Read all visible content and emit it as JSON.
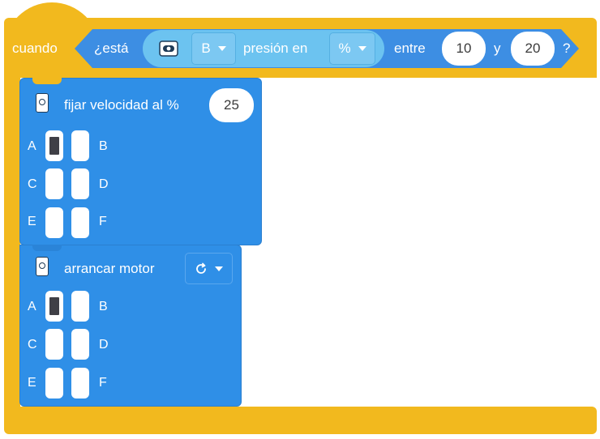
{
  "event_block": {
    "label": "cuando",
    "condition_prefix": "¿está",
    "sensor_port": "B",
    "measure_label": "presión en",
    "unit": "%",
    "between_label": "entre",
    "low_value": "10",
    "and_label": "y",
    "high_value": "20",
    "question_mark": "?",
    "icon": "force-sensor-icon",
    "color": "#f2b91e"
  },
  "speed_block": {
    "label": "fijar velocidad al %",
    "value": "25",
    "icon": "motor-icon",
    "color": "#2f8fe7",
    "ports": [
      {
        "left": "A",
        "right": "B"
      },
      {
        "left": "C",
        "right": "D"
      },
      {
        "left": "E",
        "right": "F"
      }
    ],
    "selected_port": "A"
  },
  "start_block": {
    "label": "arrancar motor",
    "direction_icon": "clockwise-arrow-icon",
    "icon": "motor-icon",
    "color": "#2f8fe7",
    "ports": [
      {
        "left": "A",
        "right": "B"
      },
      {
        "left": "C",
        "right": "D"
      },
      {
        "left": "E",
        "right": "F"
      }
    ],
    "selected_port": "A"
  }
}
